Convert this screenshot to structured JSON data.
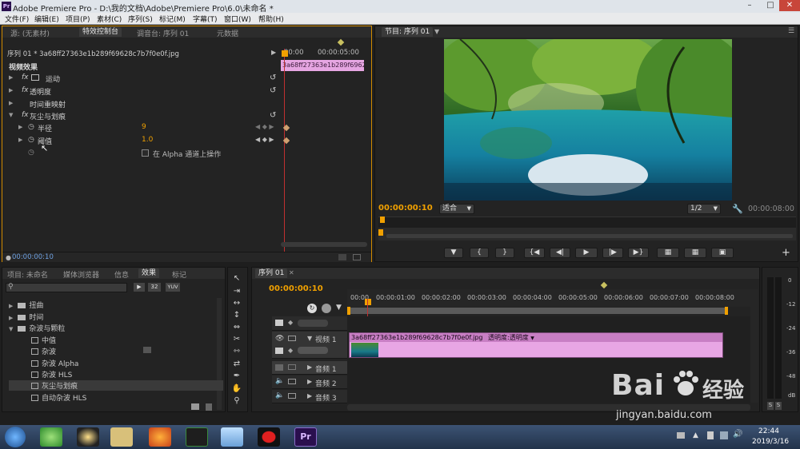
{
  "window": {
    "title": "Adobe Premiere Pro - D:\\我的文档\\Adobe\\Premiere Pro\\6.0\\未命名 *"
  },
  "menu": [
    "文件(F)",
    "编辑(E)",
    "项目(P)",
    "素材(C)",
    "序列(S)",
    "标记(M)",
    "字幕(T)",
    "窗口(W)",
    "帮助(H)"
  ],
  "source_panel": {
    "tabs": [
      "源: (无素材)",
      "特效控制台",
      "调音台: 序列 01",
      "元数据"
    ],
    "clip_path": "序列 01 * 3a68ff27363e1b289f69628c7b7f0e0f.jpg",
    "ruler_start": "00:00",
    "ruler_end": "00:00:05:00",
    "clip_bar_label": "3a68ff27363e1b289f69628c",
    "section_title": "视频效果",
    "effects": [
      {
        "label": "运动"
      },
      {
        "label": "透明度"
      },
      {
        "label": "时间重映射"
      },
      {
        "label": "灰尘与划痕"
      }
    ],
    "params": [
      {
        "label": "半径",
        "value": "9"
      },
      {
        "label": "阈值",
        "value": "1.0"
      }
    ],
    "alpha_option": "在 Alpha 通道上操作",
    "timecode": "00:00:00:10"
  },
  "program_panel": {
    "tab": "节目: 序列 01",
    "timecode": "00:00:00:10",
    "fit": "适合",
    "resolution": "1/2",
    "duration": "00:00:08:00"
  },
  "project_panel": {
    "tabs": [
      "项目: 未命名",
      "媒体浏览器",
      "信息",
      "效果",
      "标记"
    ],
    "search_placeholder": "",
    "badges": [
      "32",
      "YUV"
    ],
    "tree": [
      {
        "label": "扭曲",
        "type": "folder",
        "level": 1
      },
      {
        "label": "时间",
        "type": "folder",
        "level": 1
      },
      {
        "label": "杂波与颗粒",
        "type": "folder",
        "level": 1,
        "expanded": true
      },
      {
        "label": "中值",
        "type": "effect",
        "level": 2
      },
      {
        "label": "杂波",
        "type": "effect",
        "level": 2
      },
      {
        "label": "杂波 Alpha",
        "type": "effect",
        "level": 2
      },
      {
        "label": "杂波 HLS",
        "type": "effect",
        "level": 2
      },
      {
        "label": "灰尘与划痕",
        "type": "effect",
        "level": 2,
        "selected": true
      },
      {
        "label": "自动杂波 HLS",
        "type": "effect",
        "level": 2
      }
    ]
  },
  "timeline": {
    "tab": "序列 01",
    "timecode": "00:00:00:10",
    "ruler": [
      "00:00",
      "00:00:01:00",
      "00:00:02:00",
      "00:00:03:00",
      "00:00:04:00",
      "00:00:05:00",
      "00:00:06:00",
      "00:00:07:00",
      "00:00:08:00"
    ],
    "tracks": {
      "video1": "视频 1",
      "audio": [
        "音频 1",
        "音频 2",
        "音频 3"
      ]
    },
    "clip": {
      "name": "3a68ff27363e1b289f69628c7b7f0e0f.jpg",
      "fx_label": "透明度:透明度"
    }
  },
  "audio_meter": {
    "labels": [
      "0",
      "-12",
      "-24",
      "-36",
      "-48",
      "dB"
    ],
    "solo": [
      "S",
      "S"
    ]
  },
  "taskbar": {
    "time": "22:44",
    "date": "2019/3/16"
  },
  "watermark": {
    "brand": "Bai",
    "brand2": "经验",
    "url": "jingyan.baidu.com"
  },
  "colors": {
    "accent": "#f0a000",
    "clip": "#e8a6e4",
    "playhead": "#c03030"
  }
}
